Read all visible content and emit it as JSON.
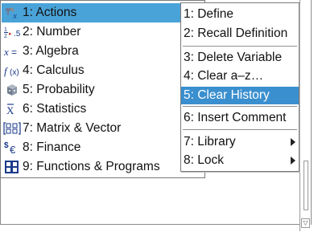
{
  "main_menu": {
    "items": [
      {
        "label": "1: Actions",
        "icon": "actions-icon"
      },
      {
        "label": "2: Number",
        "icon": "number-icon"
      },
      {
        "label": "3: Algebra",
        "icon": "algebra-icon"
      },
      {
        "label": "4: Calculus",
        "icon": "calculus-icon"
      },
      {
        "label": "5: Probability",
        "icon": "probability-icon"
      },
      {
        "label": "6: Statistics",
        "icon": "statistics-icon"
      },
      {
        "label": "7: Matrix & Vector",
        "icon": "matrix-icon"
      },
      {
        "label": "8: Finance",
        "icon": "finance-icon"
      },
      {
        "label": "9: Functions & Programs",
        "icon": "functions-programs-icon"
      }
    ],
    "selected_index": 0
  },
  "sub_menu": {
    "items": [
      {
        "label": "1: Define"
      },
      {
        "label": "2: Recall Definition"
      },
      {
        "label": "3: Delete Variable"
      },
      {
        "label": "4: Clear a–z…"
      },
      {
        "label": "5: Clear History"
      },
      {
        "label": "6: Insert Comment"
      },
      {
        "label": "7: Library"
      },
      {
        "label": "8: Lock"
      }
    ],
    "selected_index": 4
  },
  "colors": {
    "main_highlight": "#4aa3d8",
    "sub_highlight": "#3a8fcf"
  }
}
